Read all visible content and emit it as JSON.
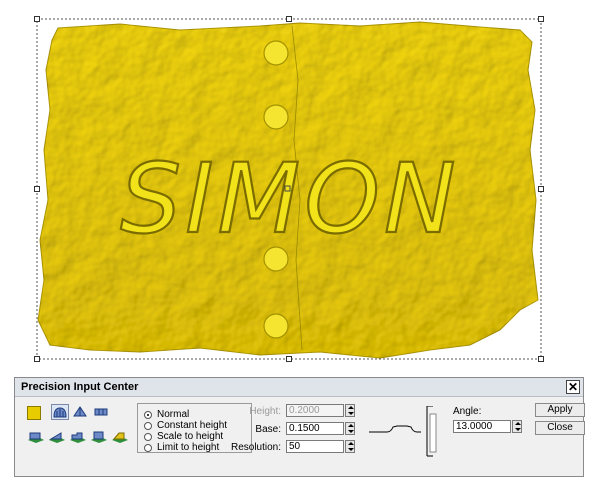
{
  "canvas": {
    "relief_text": "SIMON",
    "relief_color": "#f2e21a",
    "relief_shadow": "#c9b900"
  },
  "dialog": {
    "title": "Precision Input Center",
    "close_glyph": "✕",
    "color_swatch": "#e6cc00",
    "tool_icons_row1": [
      "dome-icon",
      "arch-icon",
      "flat-bar-icon"
    ],
    "tool_icons_row2": [
      "slab-icon",
      "slab-ramp-icon",
      "slab-step-icon",
      "slab-box-icon",
      "slab-wedge-icon"
    ],
    "mode_options": [
      {
        "label": "Normal",
        "selected": true
      },
      {
        "label": "Constant height",
        "selected": false
      },
      {
        "label": "Scale to height",
        "selected": false
      },
      {
        "label": "Limit to height",
        "selected": false
      }
    ],
    "height_label": "Height:",
    "height_value": "0.2000",
    "base_label": "Base:",
    "base_value": "0.1500",
    "resolution_label": "Resolution:",
    "resolution_value": "50",
    "angle_label": "Angle:",
    "angle_value": "13.0000",
    "apply_label": "Apply",
    "close_label": "Close"
  }
}
